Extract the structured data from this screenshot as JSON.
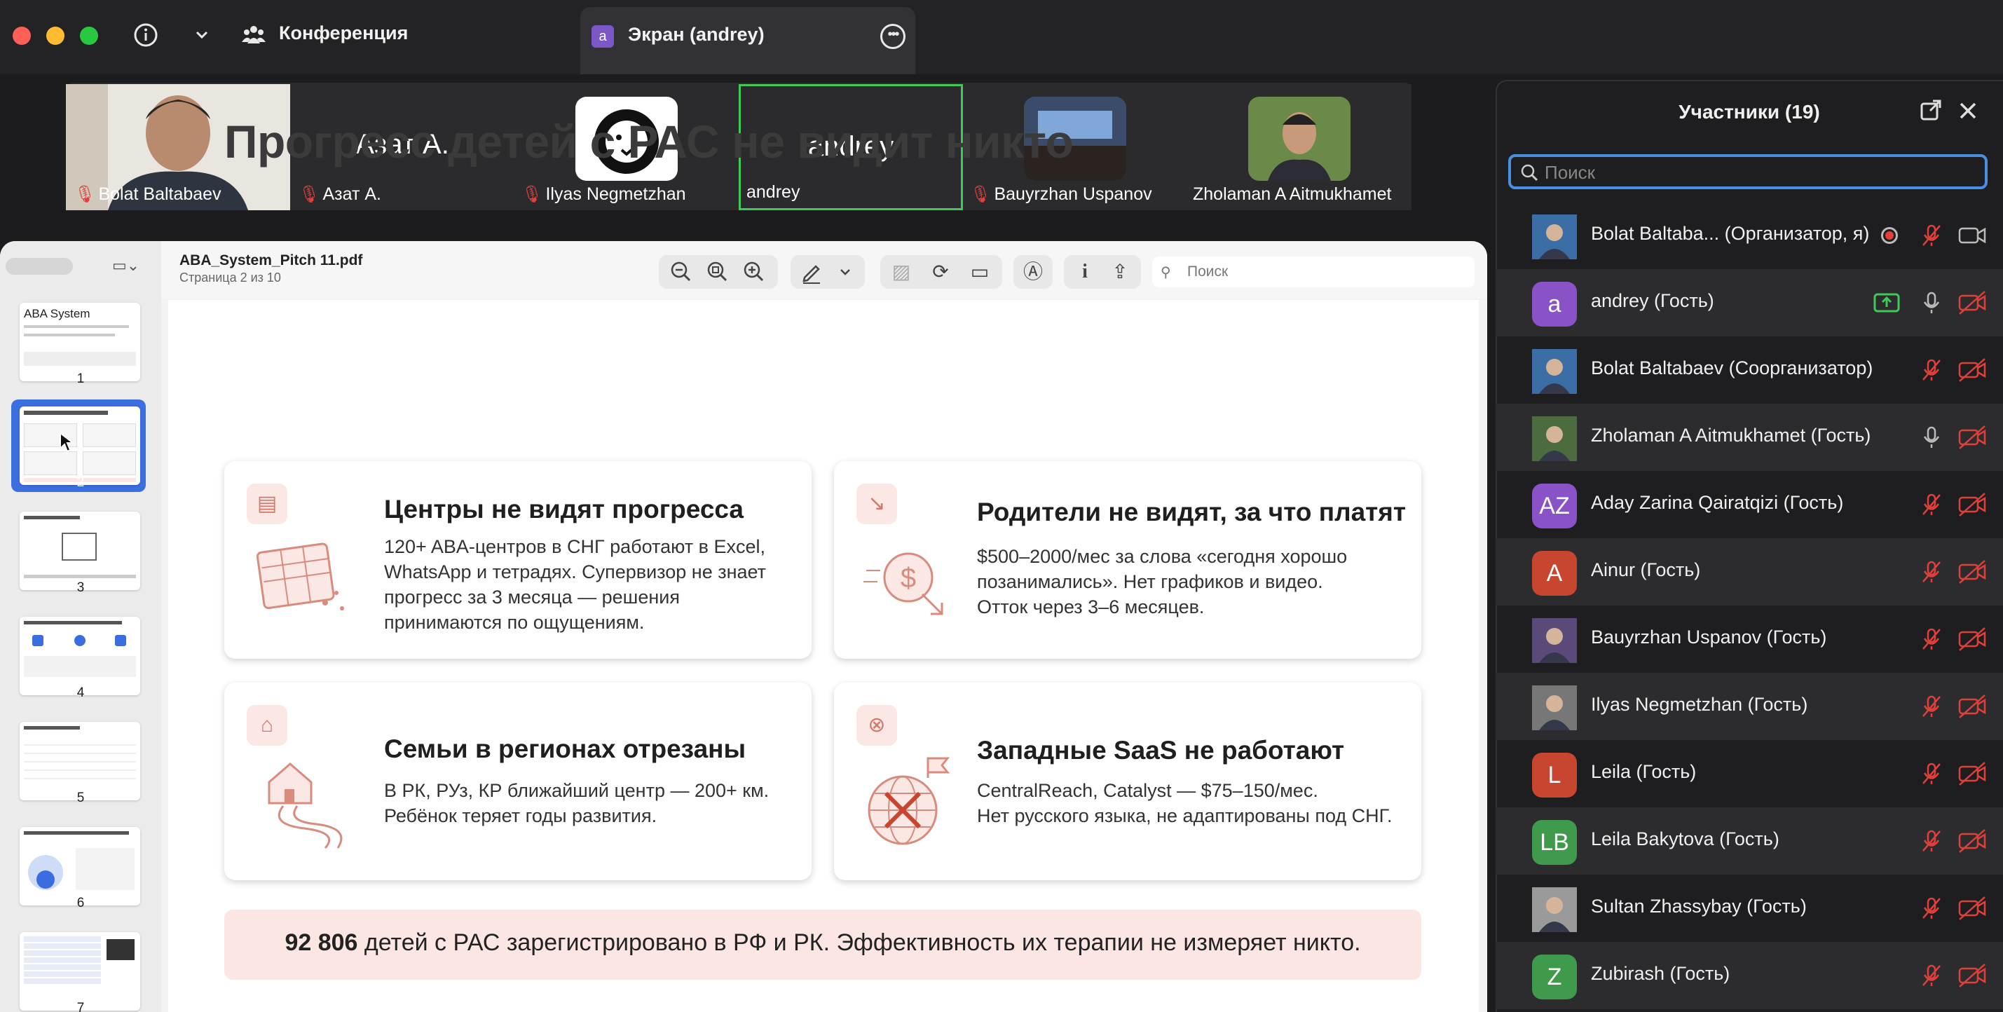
{
  "window": {
    "conference_label": "Конференция",
    "tab_label": "Экран (andrey)",
    "tab_avatar_letter": "a"
  },
  "video_tiles": [
    {
      "name": "Bolat Baltabaev",
      "muted": true,
      "kind": "photo"
    },
    {
      "name": "Азат А.",
      "big_label": "Азат А.",
      "muted": true,
      "kind": "text"
    },
    {
      "name": "Ilyas Negmetzhan",
      "muted": true,
      "kind": "logo"
    },
    {
      "name": "andrey",
      "big_label": "andrey",
      "muted": false,
      "kind": "text",
      "active": true
    },
    {
      "name": "Bauyrzhan Uspanov",
      "muted": true,
      "kind": "photo"
    },
    {
      "name": "Zholaman A Aitmukhamet",
      "muted": false,
      "kind": "photo"
    }
  ],
  "viewer": {
    "file_name": "ABA_System_Pitch 11.pdf",
    "page_info": "Страница 2 из 10",
    "search_placeholder": "Поиск",
    "thumbnails": [
      "1",
      "2",
      "3",
      "4",
      "5",
      "6",
      "7"
    ],
    "thumbnail_1_title": "ABA System"
  },
  "slide": {
    "title": "Прогресс детей с РАС не видит никто",
    "cards": [
      {
        "icon": "document-icon",
        "title": "Центры не видят прогресса",
        "lines": [
          "120+ ABA-центров в СНГ работают в Excel,",
          "WhatsApp и тетрадях. Супервизор не знает",
          "прогресс за 3 месяца — решения",
          "принимаются по ощущениям."
        ]
      },
      {
        "icon": "trend-down-icon",
        "title": "Родители не видят, за что платят",
        "lines": [
          "$500–2000/мес за слова «сегодня хорошо",
          "позанимались». Нет графиков и видео.",
          "Отток через 3–6 месяцев."
        ]
      },
      {
        "icon": "home-icon",
        "title": "Семьи в регионах отрезаны",
        "lines": [
          "В РК, РУз, КР ближайший центр — 200+ км.",
          "Ребёнок теряет годы развития."
        ]
      },
      {
        "icon": "globe-cross-icon",
        "title": "Западные SaaS не работают",
        "lines": [
          "CentralReach, Catalyst — $75–150/мес.",
          "Нет русского языка, не адаптированы под СНГ."
        ]
      }
    ],
    "banner_bold": "92 806",
    "banner_rest": " детей с РАС зарегистрировано в РФ и РК. Эффективность их терапии не измеряет никто."
  },
  "participants": {
    "title": "Участники (19)",
    "search_placeholder": "Поиск",
    "list": [
      {
        "name": "Bolat Baltaba... (Организатор, я)",
        "avatar": "photo",
        "color": "#3a6ea5",
        "mic": "muted",
        "cam": "on",
        "recording": true
      },
      {
        "name": "andrey (Гость)",
        "avatar": "a",
        "color": "#8a52c7",
        "mic": "on",
        "cam": "off",
        "sharing": true
      },
      {
        "name": "Bolat Baltabaev (Соорганизатор)",
        "avatar": "photo",
        "color": "#3a6ea5",
        "mic": "muted",
        "cam": "off"
      },
      {
        "name": "Zholaman A Aitmukhamet (Гость)",
        "avatar": "photo",
        "color": "#4c6b3f",
        "mic": "on",
        "cam": "off"
      },
      {
        "name": "Aday Zarina Qairatqizi (Гость)",
        "avatar": "AZ",
        "color": "#8a52c7",
        "mic": "muted",
        "cam": "off"
      },
      {
        "name": "Ainur (Гость)",
        "avatar": "A",
        "color": "#c8452f",
        "mic": "muted",
        "cam": "off"
      },
      {
        "name": "Bauyrzhan Uspanov (Гость)",
        "avatar": "photo",
        "color": "#5a4a7a",
        "mic": "muted",
        "cam": "off"
      },
      {
        "name": "Ilyas Negmetzhan (Гость)",
        "avatar": "photo",
        "color": "#777",
        "mic": "muted",
        "cam": "off"
      },
      {
        "name": "Leila (Гость)",
        "avatar": "L",
        "color": "#c8452f",
        "mic": "muted",
        "cam": "off"
      },
      {
        "name": "Leila Bakytova (Гость)",
        "avatar": "LB",
        "color": "#3f9a4c",
        "mic": "muted",
        "cam": "off"
      },
      {
        "name": "Sultan Zhassybay (Гость)",
        "avatar": "photo",
        "color": "#9a9a9a",
        "mic": "muted",
        "cam": "off"
      },
      {
        "name": "Zubirash (Гость)",
        "avatar": "Z",
        "color": "#3f9a4c",
        "mic": "muted",
        "cam": "off"
      }
    ]
  }
}
